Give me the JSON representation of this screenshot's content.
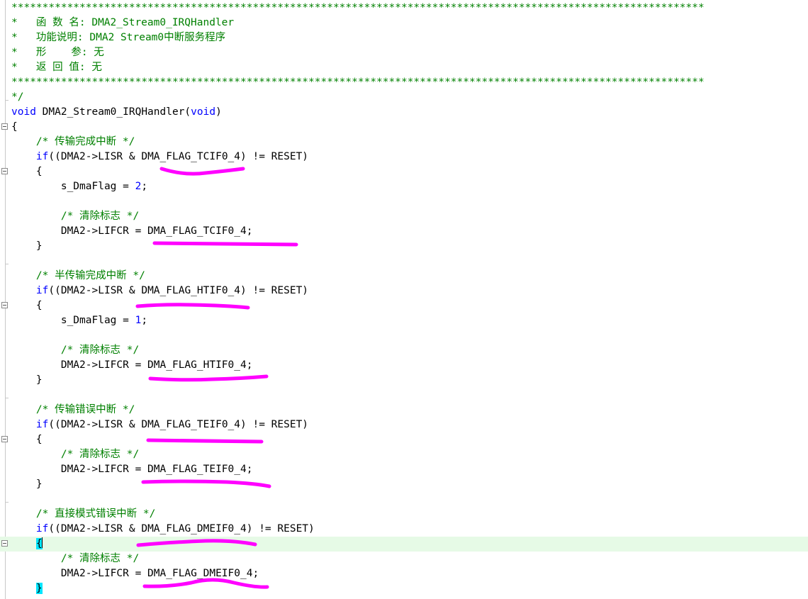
{
  "editor": {
    "lines": [
      {
        "parts": [
          {
            "t": "****************************************************************************************************************",
            "c": "comment"
          }
        ]
      },
      {
        "parts": [
          {
            "t": "*   函 数 名: DMA2_Stream0_IRQHandler",
            "c": "comment"
          }
        ]
      },
      {
        "parts": [
          {
            "t": "*   功能说明: DMA2 Stream0中断服务程序",
            "c": "comment"
          }
        ]
      },
      {
        "parts": [
          {
            "t": "*   形    参: 无",
            "c": "comment"
          }
        ]
      },
      {
        "parts": [
          {
            "t": "*   返 回 值: 无",
            "c": "comment"
          }
        ]
      },
      {
        "parts": [
          {
            "t": "****************************************************************************************************************",
            "c": "comment"
          }
        ]
      },
      {
        "parts": [
          {
            "t": "*/",
            "c": "comment"
          }
        ]
      },
      {
        "parts": [
          {
            "t": "void",
            "c": "kw"
          },
          {
            "t": " DMA2_Stream0_IRQHandler(",
            "c": ""
          },
          {
            "t": "void",
            "c": "kw"
          },
          {
            "t": ")",
            "c": ""
          }
        ]
      },
      {
        "parts": [
          {
            "t": "{",
            "c": ""
          }
        ]
      },
      {
        "parts": [
          {
            "t": "    ",
            "c": ""
          },
          {
            "t": "/* 传输完成中断 */",
            "c": "comment"
          }
        ]
      },
      {
        "parts": [
          {
            "t": "    ",
            "c": ""
          },
          {
            "t": "if",
            "c": "kw"
          },
          {
            "t": "((DMA2->LISR & DMA_FLAG_TCIF0_4) != RESET)",
            "c": ""
          }
        ]
      },
      {
        "parts": [
          {
            "t": "    {",
            "c": ""
          }
        ]
      },
      {
        "parts": [
          {
            "t": "        s_DmaFlag = ",
            "c": ""
          },
          {
            "t": "2",
            "c": "num"
          },
          {
            "t": ";",
            "c": ""
          }
        ]
      },
      {
        "parts": [
          {
            "t": "",
            "c": ""
          }
        ]
      },
      {
        "parts": [
          {
            "t": "        ",
            "c": ""
          },
          {
            "t": "/* 清除标志 */",
            "c": "comment"
          }
        ]
      },
      {
        "parts": [
          {
            "t": "        DMA2->LIFCR = DMA_FLAG_TCIF0_4;",
            "c": ""
          }
        ]
      },
      {
        "parts": [
          {
            "t": "    }",
            "c": ""
          }
        ]
      },
      {
        "parts": [
          {
            "t": "",
            "c": ""
          }
        ]
      },
      {
        "parts": [
          {
            "t": "    ",
            "c": ""
          },
          {
            "t": "/* 半传输完成中断 */",
            "c": "comment"
          }
        ]
      },
      {
        "parts": [
          {
            "t": "    ",
            "c": ""
          },
          {
            "t": "if",
            "c": "kw"
          },
          {
            "t": "((DMA2->LISR & DMA_FLAG_HTIF0_4) != RESET)",
            "c": ""
          }
        ]
      },
      {
        "parts": [
          {
            "t": "    {",
            "c": ""
          }
        ]
      },
      {
        "parts": [
          {
            "t": "        s_DmaFlag = ",
            "c": ""
          },
          {
            "t": "1",
            "c": "num"
          },
          {
            "t": ";",
            "c": ""
          }
        ]
      },
      {
        "parts": [
          {
            "t": "",
            "c": ""
          }
        ]
      },
      {
        "parts": [
          {
            "t": "        ",
            "c": ""
          },
          {
            "t": "/* 清除标志 */",
            "c": "comment"
          }
        ]
      },
      {
        "parts": [
          {
            "t": "        DMA2->LIFCR = DMA_FLAG_HTIF0_4;",
            "c": ""
          }
        ]
      },
      {
        "parts": [
          {
            "t": "    }",
            "c": ""
          }
        ]
      },
      {
        "parts": [
          {
            "t": "",
            "c": ""
          }
        ]
      },
      {
        "parts": [
          {
            "t": "    ",
            "c": ""
          },
          {
            "t": "/* 传输错误中断 */",
            "c": "comment"
          }
        ]
      },
      {
        "parts": [
          {
            "t": "    ",
            "c": ""
          },
          {
            "t": "if",
            "c": "kw"
          },
          {
            "t": "((DMA2->LISR & DMA_FLAG_TEIF0_4) != RESET)",
            "c": ""
          }
        ]
      },
      {
        "parts": [
          {
            "t": "    {",
            "c": ""
          }
        ]
      },
      {
        "parts": [
          {
            "t": "        ",
            "c": ""
          },
          {
            "t": "/* 清除标志 */",
            "c": "comment"
          }
        ]
      },
      {
        "parts": [
          {
            "t": "        DMA2->LIFCR = DMA_FLAG_TEIF0_4;",
            "c": ""
          }
        ]
      },
      {
        "parts": [
          {
            "t": "    }",
            "c": ""
          }
        ]
      },
      {
        "parts": [
          {
            "t": "",
            "c": ""
          }
        ]
      },
      {
        "parts": [
          {
            "t": "    ",
            "c": ""
          },
          {
            "t": "/* 直接模式错误中断 */",
            "c": "comment"
          }
        ]
      },
      {
        "parts": [
          {
            "t": "    ",
            "c": ""
          },
          {
            "t": "if",
            "c": "kw"
          },
          {
            "t": "((DMA2->LISR & DMA_FLAG_DMEIF0_4) != RESET)",
            "c": ""
          }
        ]
      },
      {
        "parts": [
          {
            "t": "    ",
            "c": ""
          },
          {
            "t": "{",
            "c": "brace-hl"
          }
        ]
      },
      {
        "parts": [
          {
            "t": "        ",
            "c": ""
          },
          {
            "t": "/* 清除标志 */",
            "c": "comment"
          }
        ]
      },
      {
        "parts": [
          {
            "t": "        DMA2->LIFCR = DMA_FLAG_DMEIF0_4;",
            "c": ""
          }
        ]
      },
      {
        "parts": [
          {
            "t": "    ",
            "c": ""
          },
          {
            "t": "}",
            "c": "brace-hl"
          }
        ]
      }
    ],
    "current_line_index": 36,
    "fold_markers": [
      8,
      11,
      20,
      29,
      36
    ],
    "colors": {
      "comment": "#008000",
      "keyword": "#0000ff",
      "current_line_bg": "#e6fae6",
      "brace_match": "#00e5ff",
      "annotation": "#ff00ff"
    }
  },
  "annotations": {
    "marker_color": "#ff00ff",
    "underlines": [
      "DMA_FLAG_TCIF0_4 (LISR)",
      "DMA_FLAG_TCIF0_4 (LIFCR)",
      "DMA_FLAG_HTIF0_4 (LISR)",
      "DMA_FLAG_HTIF0_4 (LIFCR)",
      "DMA_FLAG_TEIF0_4 (LISR)",
      "DMA_FLAG_TEIF0_4 (LIFCR)",
      "DMA_FLAG_DMEIF0_4 (LISR)",
      "DMA_FLAG_DMEIF0_4 (LIFCR)"
    ]
  }
}
